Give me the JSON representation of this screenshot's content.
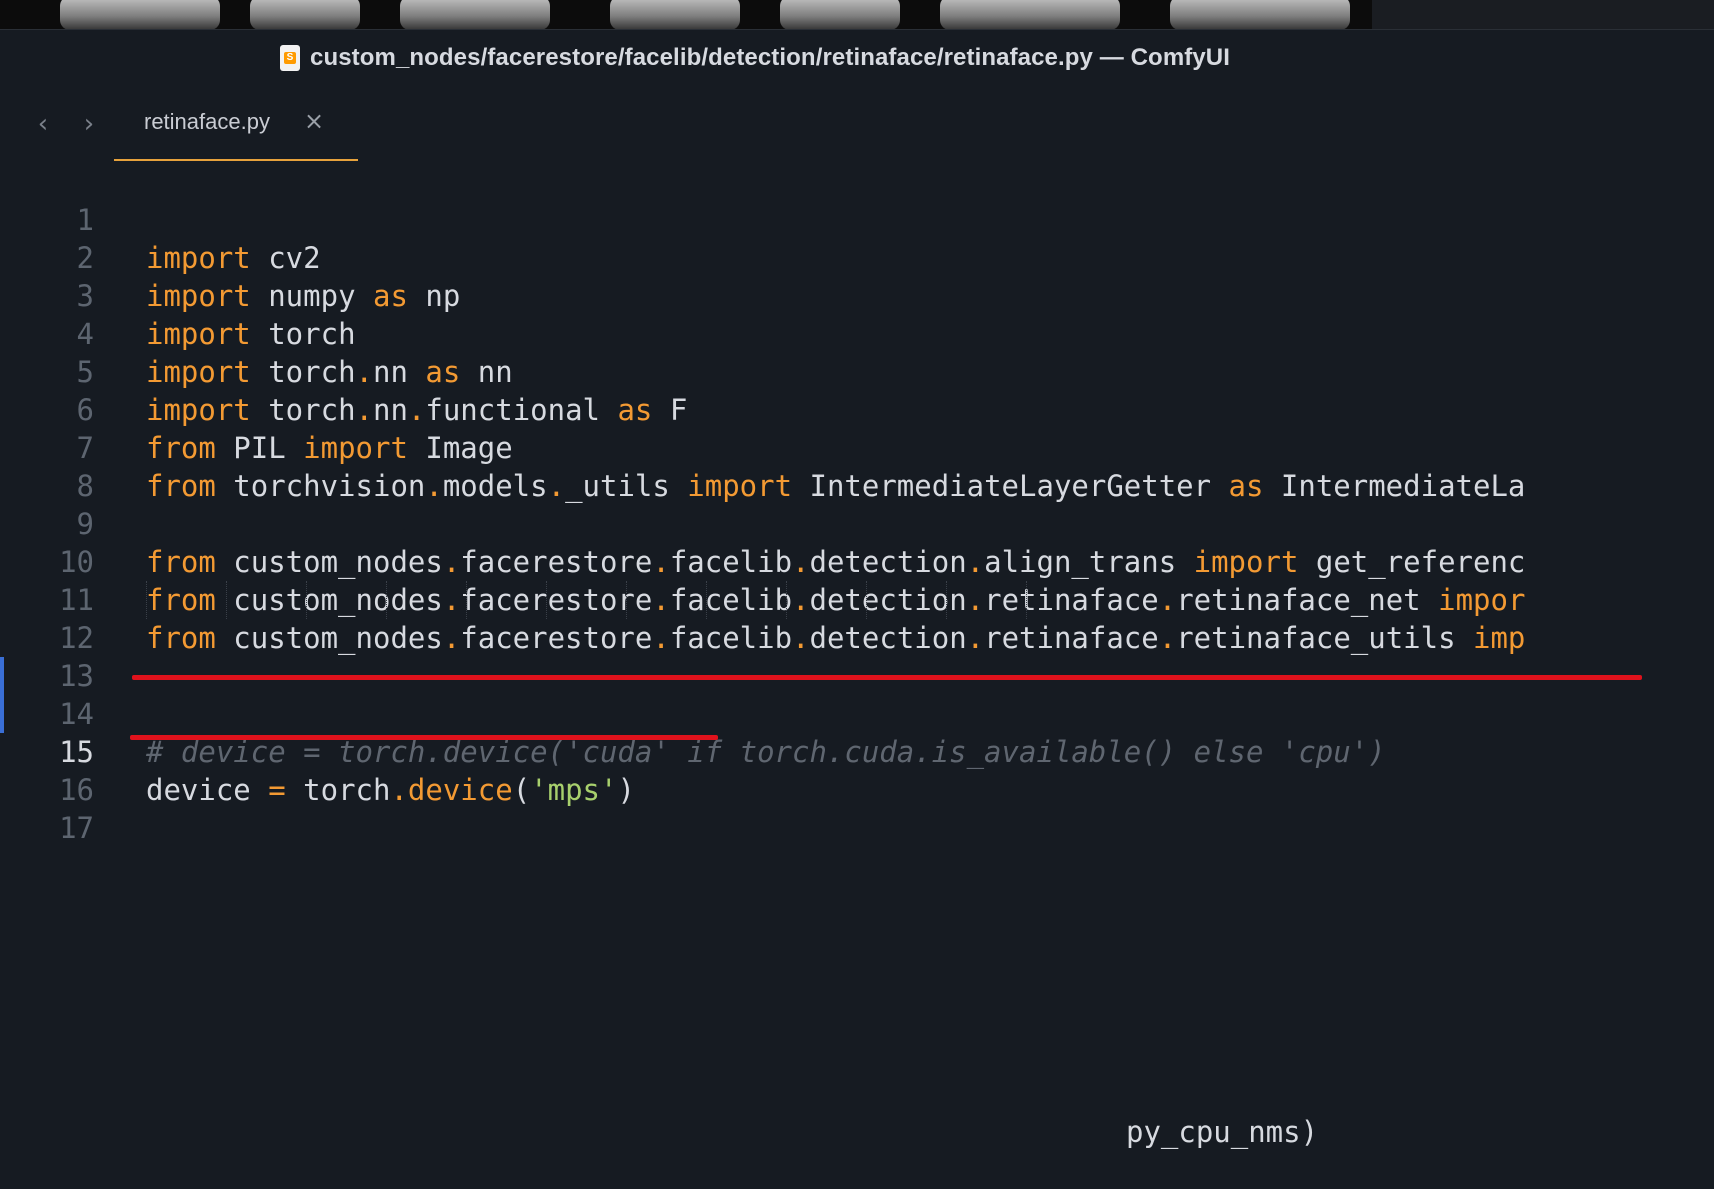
{
  "window": {
    "title": "custom_nodes/facerestore/facelib/detection/retinaface/retinaface.py — ComfyUI"
  },
  "tabs": {
    "nav_back": "‹",
    "nav_forward": "›",
    "active_tab_label": "retinaface.py",
    "close_glyph": "×"
  },
  "editor": {
    "line_numbers": [
      "1",
      "2",
      "3",
      "4",
      "5",
      "6",
      "7",
      "8",
      "9",
      "10",
      "11",
      "12",
      "13",
      "14",
      "15",
      "16",
      "17"
    ],
    "lines": {
      "l1_kw": "import",
      "l1_rest": " cv2",
      "l2_kw": "import",
      "l2_a": " numpy ",
      "l2_as": "as",
      "l2_b": " np",
      "l3_kw": "import",
      "l3_rest": " torch",
      "l4_kw": "import",
      "l4_a": " torch",
      "l4_b": "nn ",
      "l4_as": "as",
      "l4_c": " nn",
      "l5_kw": "import",
      "l5_a": " torch",
      "l5_b": "nn",
      "l5_c": "functional ",
      "l5_as": "as",
      "l5_d": " F",
      "l6_kw": "from",
      "l6_a": " PIL ",
      "l6_imp": "import",
      "l6_b": " Image",
      "l7_kw": "from",
      "l7_a": " torchvision",
      "l7_b": "models",
      "l7_c": "_utils ",
      "l7_imp": "import",
      "l7_d": " IntermediateLayerGetter ",
      "l7_as": "as",
      "l7_e": " IntermediateLa",
      "l9_kw": "from",
      "l9_a": " custom_nodes",
      "l9_b": "facerestore",
      "l9_c": "facelib",
      "l9_d": "detection",
      "l9_e": "align_trans ",
      "l9_imp": "import",
      "l9_f": " get_referenc",
      "l10_kw": "from",
      "l10_a": " custom_nodes",
      "l10_b": "facerestore",
      "l10_c": "facelib",
      "l10_d": "detection",
      "l10_e": "retinaface",
      "l10_f": "retinaface_net ",
      "l10_imp": "impor",
      "l11_kw": "from",
      "l11_a": " custom_nodes",
      "l11_b": "facerestore",
      "l11_c": "facelib",
      "l11_d": "detection",
      "l11_e": "retinaface",
      "l11_f": "retinaface_utils ",
      "l11_imp": "imp",
      "l12_text": "py_cpu_nms)",
      "l14_comment": "# device = torch.device('cuda' if torch.cuda.is_available() else 'cpu')",
      "l15_a": "device ",
      "l15_eq": "=",
      "l15_b": " torch",
      "l15_fn": "device",
      "l15_paren_open": "(",
      "l15_str": "'mps'",
      "l15_paren_close": ")"
    },
    "dot_glyph": "."
  },
  "colors": {
    "keyword": "#f39a33",
    "string": "#a8d06d",
    "comment": "#5f6670",
    "annotation_red": "#e0121c",
    "tab_underline": "#e6a23c"
  }
}
